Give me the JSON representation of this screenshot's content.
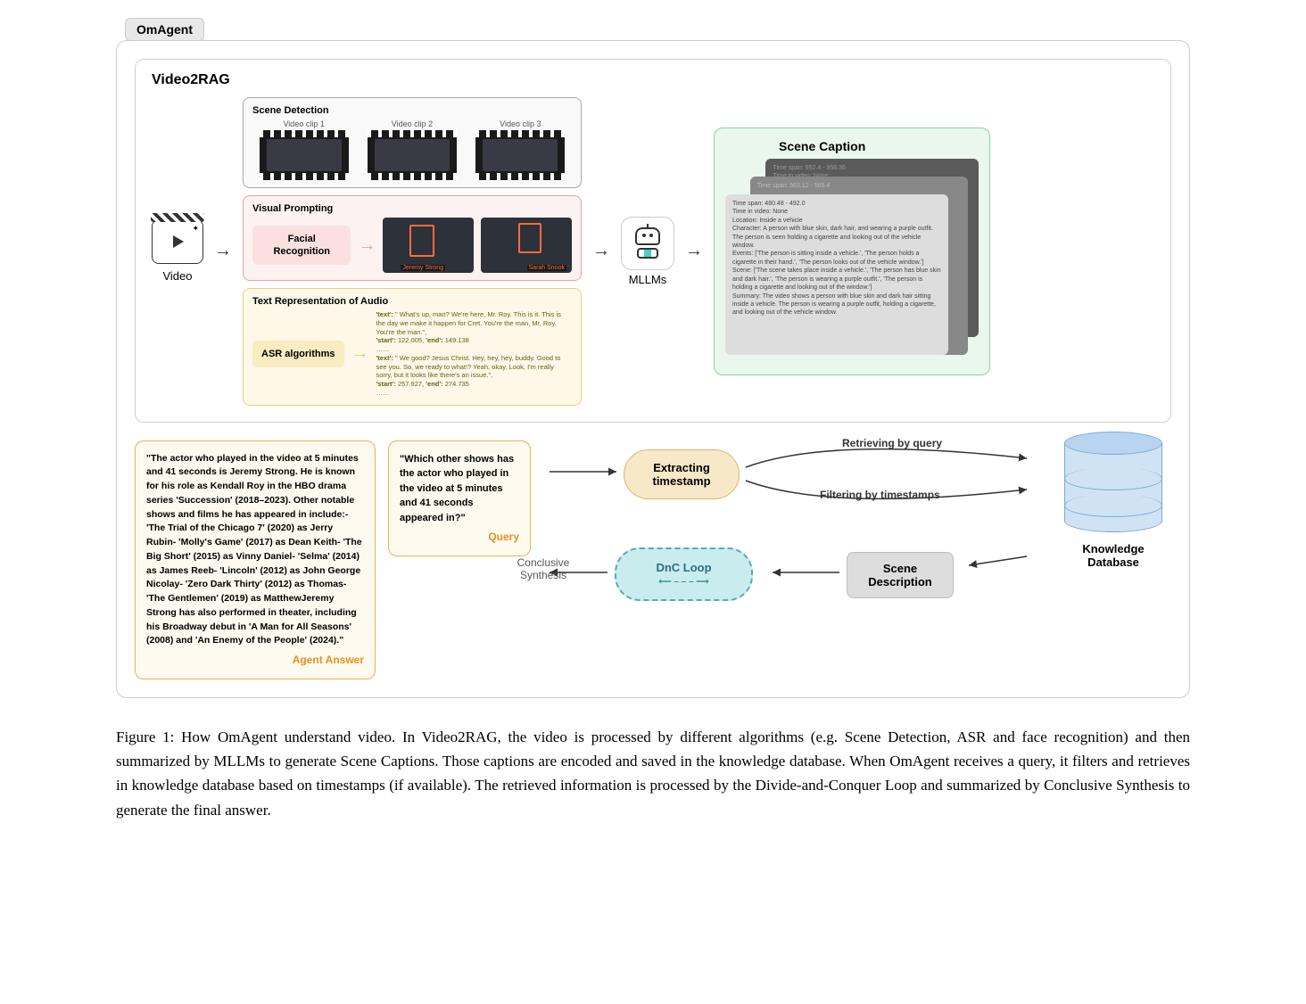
{
  "tag": "OmAgent",
  "v2r": {
    "title": "Video2RAG",
    "video_label": "Video",
    "scene_detection": {
      "title": "Scene Detection",
      "clips": [
        "Video clip 1",
        "Video clip 2",
        "Video clip 3"
      ]
    },
    "visual_prompting": {
      "title": "Visual Prompting",
      "method": "Facial Recognition",
      "names": [
        "Jeremy Strong",
        "Sarah Snook"
      ]
    },
    "asr": {
      "title": "Text Representation of Audio",
      "method": "ASR algorithms",
      "segments": [
        {
          "text": "\" What's up, man? We're here, Mr. Roy. This is it. This is the day we make it happen for Cret. You're the man, Mr. Roy. You're the man.\",",
          "start": "122.005",
          "end": "149.138"
        },
        {
          "text": "\" We good? Jesus Christ. Hey, hey, hey, buddy. Good to see you. So, we ready to what!? Yeah, okay. Look, I'm really sorry, but it looks like there's an issue.\",",
          "start": "257.927",
          "end": "274.735"
        }
      ]
    },
    "mllm_label": "MLLMs",
    "scene_caption": {
      "title": "Scene Caption",
      "bg1": "Time span: 952.4 - 956.36\nTime in video: None",
      "bg2": "Time span: 563.12 - 565.4",
      "main": "Time span: 480.48 - 492.0\nTime in video: None\nLocation: Inside a vehicle\nCharacter: A person with blue skin, dark hair, and wearing a purple outfit. The person is seen holding a cigarette and looking out of the vehicle window.\nEvents: ['The person is sitting inside a vehicle.', 'The person holds a cigarette in their hand.', 'The person looks out of the vehicle window.']\nScene: ['The scene takes place inside a vehicle.', 'The person has blue skin and dark hair.', 'The person is wearing a purple outfit.', 'The person is holding a cigarette and looking out of the window.']\nSummary: The video shows a person with blue skin and dark hair sitting inside a vehicle. The person is wearing a purple outfit, holding a cigarette, and looking out of the vehicle window."
    }
  },
  "agent_answer": "\"The actor who played in the video at 5 minutes and 41 seconds is Jeremy Strong. He is known for his role as Kendall Roy in the HBO drama series 'Succession' (2018–2023). Other notable shows and films he has appeared in include:- 'The Trial of the Chicago 7' (2020) as Jerry Rubin- 'Molly's Game' (2017) as Dean Keith- 'The Big Short' (2015) as Vinny Daniel- 'Selma' (2014) as James Reeb- 'Lincoln' (2012) as John George Nicolay- 'Zero Dark Thirty' (2012) as Thomas- 'The Gentlemen' (2019) as MatthewJeremy Strong has also performed in theater, including his Broadway debut in 'A Man for All Seasons' (2008) and 'An Enemy of the People' (2024).\"",
  "agent_answer_label": "Agent Answer",
  "query": "\"Which other shows has the actor who played in the video at 5 minutes and 41 seconds appeared in?\"",
  "query_label": "Query",
  "flow": {
    "extract": "Extracting timestamp",
    "retrieve": "Retrieving by query",
    "filter": "Filtering by timestamps",
    "dnc": "DnC Loop",
    "scene_desc": "Scene Description",
    "conclusive": "Conclusive Synthesis",
    "db": "Knowledge Database"
  },
  "caption": "Figure 1: How OmAgent understand video. In Video2RAG, the video is processed by different algorithms (e.g. Scene Detection, ASR and face recognition) and then summarized by MLLMs to generate Scene Captions. Those captions are encoded and saved in the knowledge database. When OmAgent receives a query, it filters and retrieves in knowledge database based on timestamps (if available). The retrieved information is processed by the Divide-and-Conquer Loop and summarized by Conclusive Synthesis to generate the final answer."
}
